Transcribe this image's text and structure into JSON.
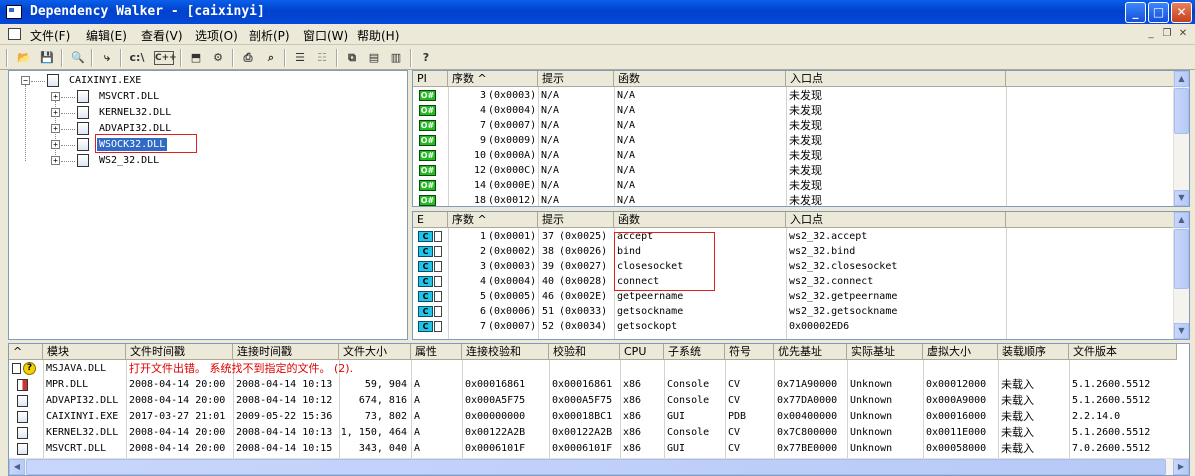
{
  "window": {
    "title": "Dependency Walker - [caixinyi]"
  },
  "menu": [
    "文件(F)",
    "编辑(E)",
    "查看(V)",
    "选项(O)",
    "剖析(P)",
    "窗口(W)",
    "帮助(H)"
  ],
  "toolbar": [
    "open-icon",
    "save-icon",
    "find-icon",
    "module-tree-icon",
    "c-path-icon",
    "cpp-icon",
    "view-icon",
    "config-icon",
    "print-icon",
    "preview-icon",
    "list-icon",
    "properties-icon",
    "cascade-icon",
    "tile-h-icon",
    "tile-v-icon",
    "help-icon"
  ],
  "toolbar_text": {
    "c_path": "c:\\",
    "cpp": "C++"
  },
  "tree": {
    "root": "CAIXINYI.EXE",
    "children": [
      "MSVCRT.DLL",
      "KERNEL32.DLL",
      "ADVAPI32.DLL",
      "WSOCK32.DLL",
      "WS2_32.DLL"
    ],
    "selected": "WSOCK32.DLL"
  },
  "imports": {
    "headers": [
      "PI",
      "序数 ^",
      "提示",
      "函数",
      "入口点"
    ],
    "badge": "O#",
    "rows": [
      {
        "ord": "3",
        "hex": "(0x0003)",
        "hint": "N/A",
        "func": "N/A",
        "entry": "未发现"
      },
      {
        "ord": "4",
        "hex": "(0x0004)",
        "hint": "N/A",
        "func": "N/A",
        "entry": "未发现"
      },
      {
        "ord": "7",
        "hex": "(0x0007)",
        "hint": "N/A",
        "func": "N/A",
        "entry": "未发现"
      },
      {
        "ord": "9",
        "hex": "(0x0009)",
        "hint": "N/A",
        "func": "N/A",
        "entry": "未发现"
      },
      {
        "ord": "10",
        "hex": "(0x000A)",
        "hint": "N/A",
        "func": "N/A",
        "entry": "未发现"
      },
      {
        "ord": "12",
        "hex": "(0x000C)",
        "hint": "N/A",
        "func": "N/A",
        "entry": "未发现"
      },
      {
        "ord": "14",
        "hex": "(0x000E)",
        "hint": "N/A",
        "func": "N/A",
        "entry": "未发现"
      },
      {
        "ord": "18",
        "hex": "(0x0012)",
        "hint": "N/A",
        "func": "N/A",
        "entry": "未发现"
      }
    ]
  },
  "exports": {
    "headers": [
      "E",
      "序数 ^",
      "提示",
      "函数",
      "入口点"
    ],
    "badge": "C",
    "rows": [
      {
        "ord": "1",
        "hex": "(0x0001)",
        "hint": "37",
        "hinthex": "(0x0025)",
        "func": "accept",
        "entry": "ws2_32.accept"
      },
      {
        "ord": "2",
        "hex": "(0x0002)",
        "hint": "38",
        "hinthex": "(0x0026)",
        "func": "bind",
        "entry": "ws2_32.bind"
      },
      {
        "ord": "3",
        "hex": "(0x0003)",
        "hint": "39",
        "hinthex": "(0x0027)",
        "func": "closesocket",
        "entry": "ws2_32.closesocket"
      },
      {
        "ord": "4",
        "hex": "(0x0004)",
        "hint": "40",
        "hinthex": "(0x0028)",
        "func": "connect",
        "entry": "ws2_32.connect"
      },
      {
        "ord": "5",
        "hex": "(0x0005)",
        "hint": "46",
        "hinthex": "(0x002E)",
        "func": "getpeername",
        "entry": "ws2_32.getpeername"
      },
      {
        "ord": "6",
        "hex": "(0x0006)",
        "hint": "51",
        "hinthex": "(0x0033)",
        "func": "getsockname",
        "entry": "ws2_32.getsockname"
      },
      {
        "ord": "7",
        "hex": "(0x0007)",
        "hint": "52",
        "hinthex": "(0x0034)",
        "func": "getsockopt",
        "entry": "0x00002ED6"
      }
    ]
  },
  "modules": {
    "headers": [
      "^",
      "模块",
      "文件时间戳",
      "连接时间戳",
      "文件大小",
      "属性",
      "连接校验和",
      "校验和",
      "CPU",
      "子系统",
      "符号",
      "优先基址",
      "实际基址",
      "虚拟大小",
      "装载顺序",
      "文件版本"
    ],
    "error_module": "MSJAVA.DLL",
    "error_text": "打开文件出错。 系统找不到指定的文件。 (2).",
    "rows": [
      [
        "MPR.DLL",
        "2008-04-14 20:00",
        "2008-04-14 10:13",
        "59, 904",
        "A",
        "0x00016861",
        "0x00016861",
        "x86",
        "Console",
        "CV",
        "0x71A90000",
        "Unknown",
        "0x00012000",
        "未载入",
        "5.1.2600.5512"
      ],
      [
        "ADVAPI32.DLL",
        "2008-04-14 20:00",
        "2008-04-14 10:12",
        "674, 816",
        "A",
        "0x000A5F75",
        "0x000A5F75",
        "x86",
        "Console",
        "CV",
        "0x77DA0000",
        "Unknown",
        "0x000A9000",
        "未载入",
        "5.1.2600.5512"
      ],
      [
        "CAIXINYI.EXE",
        "2017-03-27 21:01",
        "2009-05-22 15:36",
        "73, 802",
        "A",
        "0x00000000",
        "0x00018BC1",
        "x86",
        "GUI",
        "PDB",
        "0x00400000",
        "Unknown",
        "0x00016000",
        "未载入",
        "2.2.14.0"
      ],
      [
        "KERNEL32.DLL",
        "2008-04-14 20:00",
        "2008-04-14 10:13",
        "1, 150, 464",
        "A",
        "0x00122A2B",
        "0x00122A2B",
        "x86",
        "Console",
        "CV",
        "0x7C800000",
        "Unknown",
        "0x0011E000",
        "未载入",
        "5.1.2600.5512"
      ],
      [
        "MSVCRT.DLL",
        "2008-04-14 20:00",
        "2008-04-14 10:15",
        "343, 040",
        "A",
        "0x0006101F",
        "0x0006101F",
        "x86",
        "GUI",
        "CV",
        "0x77BE0000",
        "Unknown",
        "0x00058000",
        "未载入",
        "7.0.2600.5512"
      ]
    ]
  },
  "colors": {
    "title_blue": "#0042CC",
    "highlight_red": "#E02020",
    "import_badge": "#22BB22",
    "export_badge": "#22C4E8"
  }
}
